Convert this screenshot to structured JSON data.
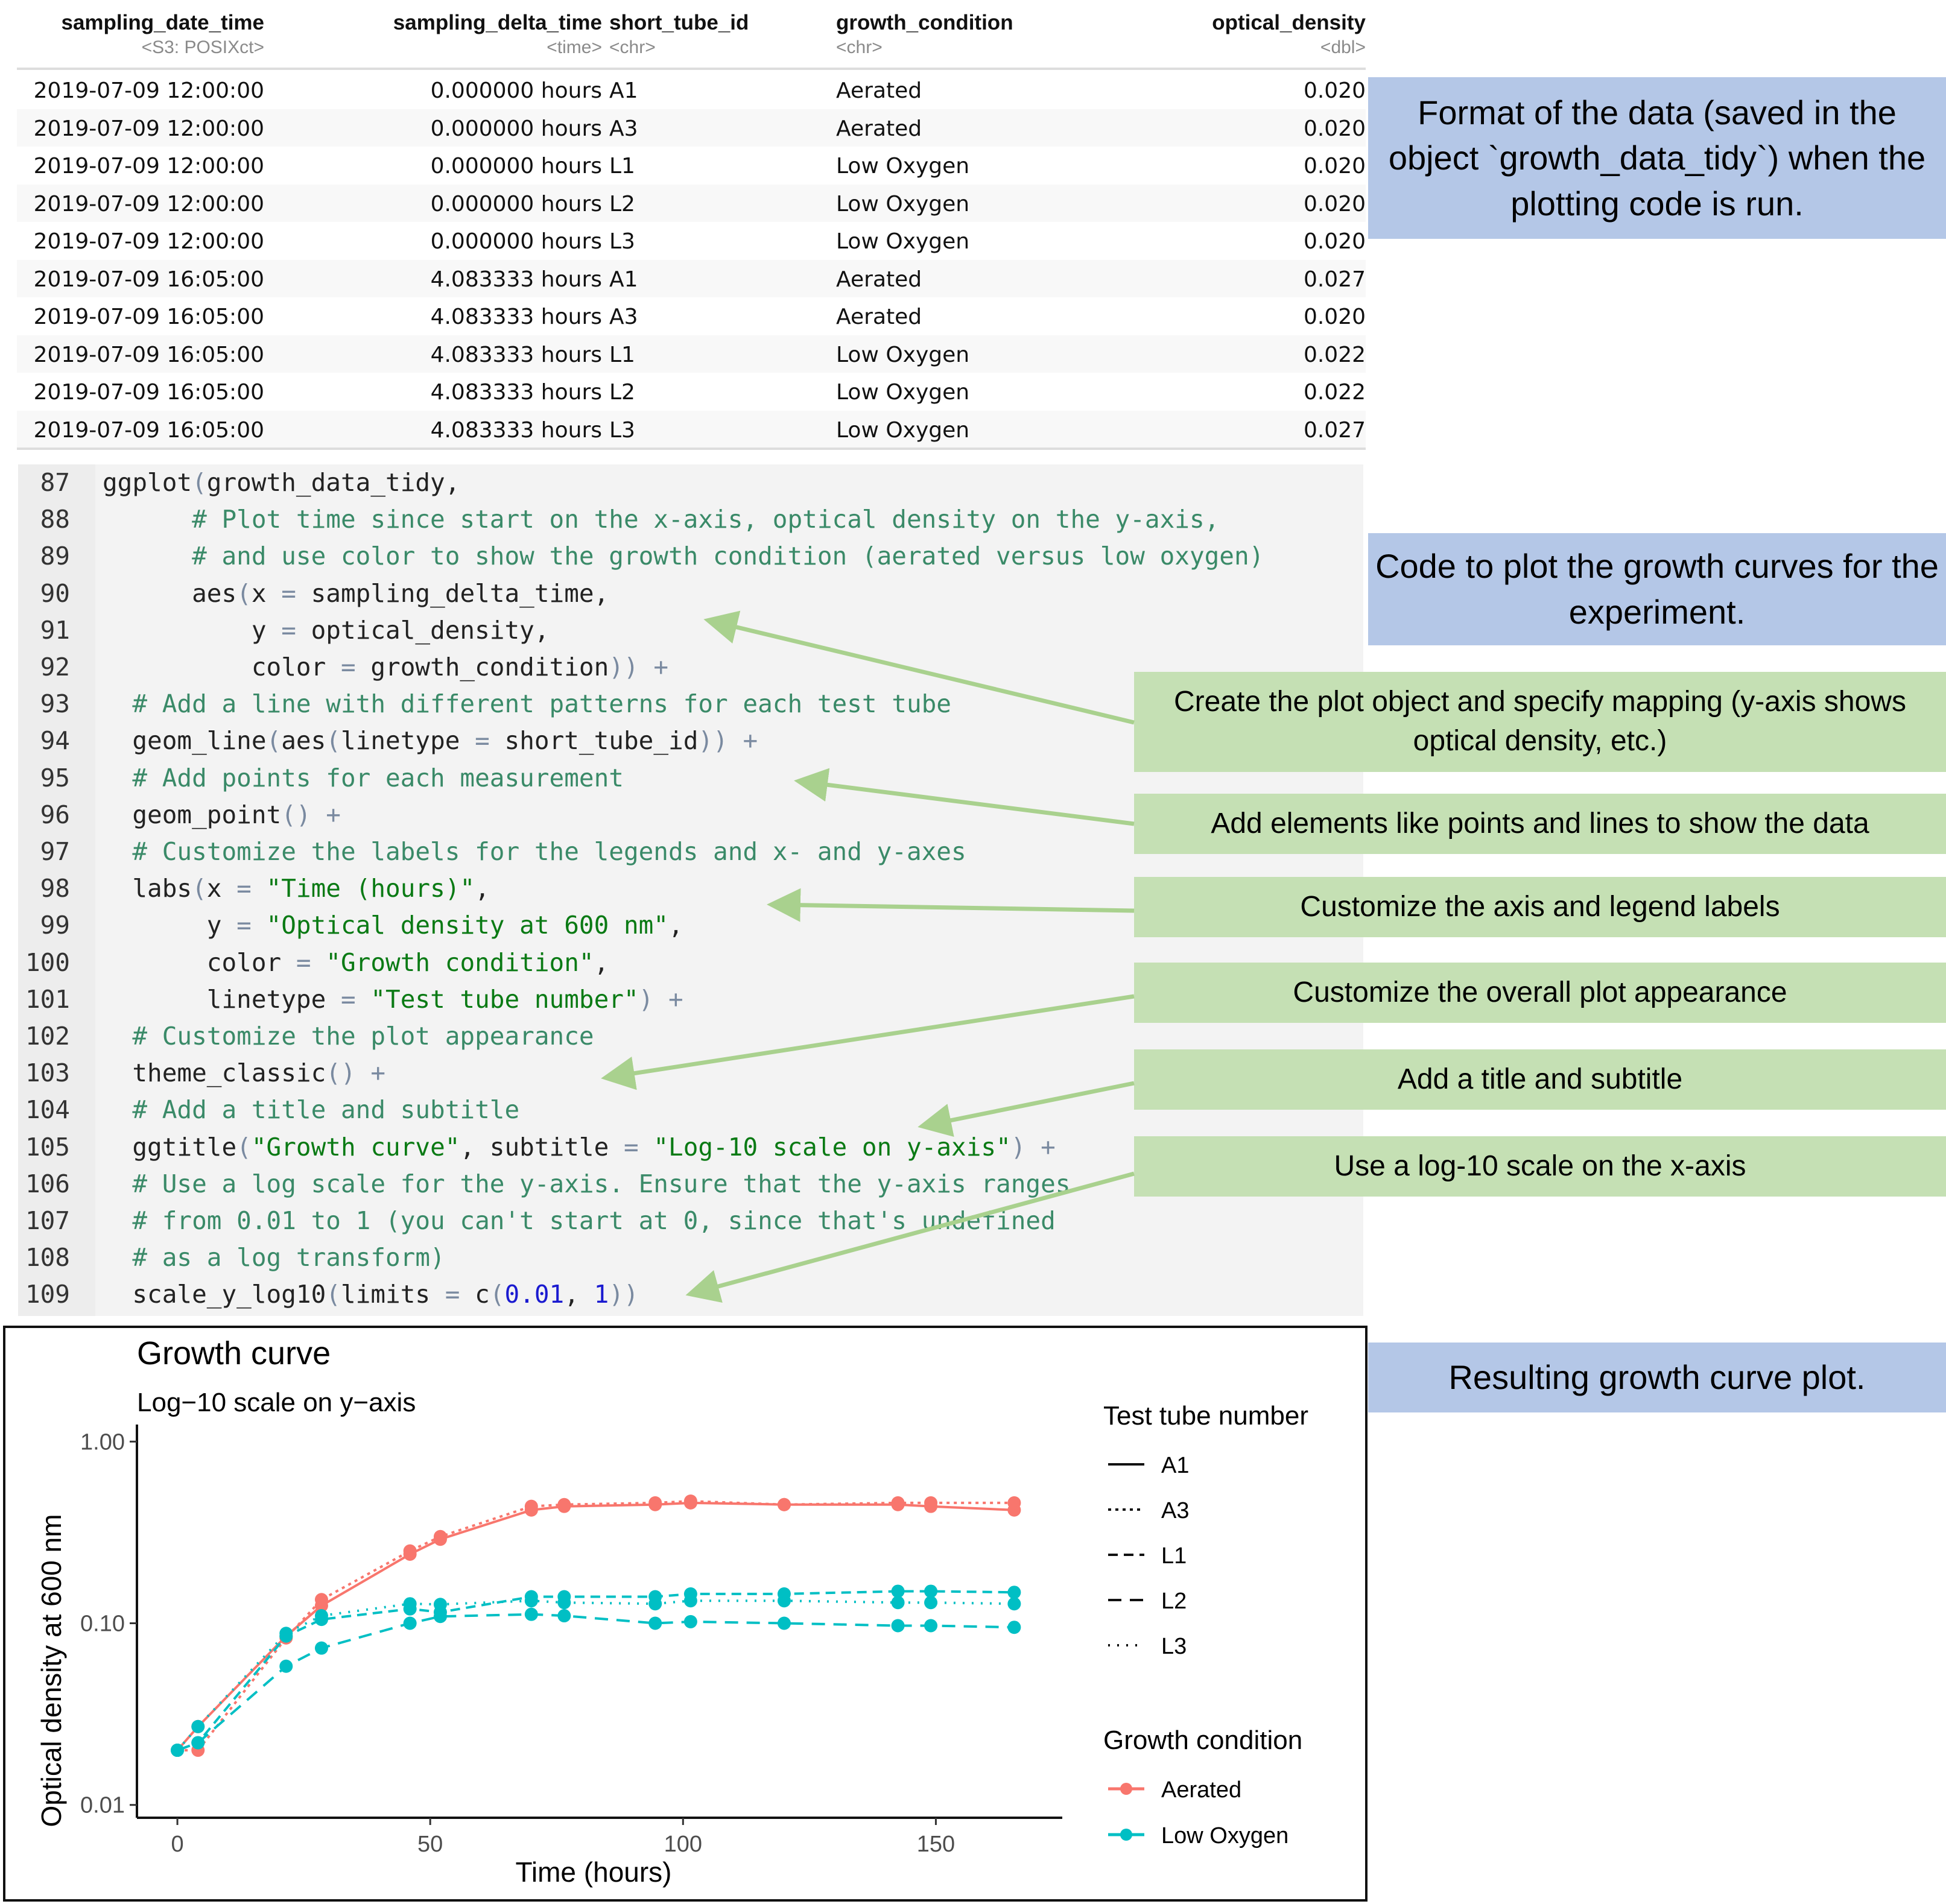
{
  "table": {
    "columns": [
      {
        "name": "sampling_date_time",
        "type": "<S3: POSIXct>"
      },
      {
        "name": "sampling_delta_time",
        "type": "<time>"
      },
      {
        "name": "short_tube_id",
        "type": "<chr>"
      },
      {
        "name": "growth_condition",
        "type": "<chr>"
      },
      {
        "name": "optical_density",
        "type": "<dbl>"
      }
    ],
    "rows": [
      [
        "2019-07-09 12:00:00",
        "0.000000 hours",
        "A1",
        "Aerated",
        "0.020"
      ],
      [
        "2019-07-09 12:00:00",
        "0.000000 hours",
        "A3",
        "Aerated",
        "0.020"
      ],
      [
        "2019-07-09 12:00:00",
        "0.000000 hours",
        "L1",
        "Low Oxygen",
        "0.020"
      ],
      [
        "2019-07-09 12:00:00",
        "0.000000 hours",
        "L2",
        "Low Oxygen",
        "0.020"
      ],
      [
        "2019-07-09 12:00:00",
        "0.000000 hours",
        "L3",
        "Low Oxygen",
        "0.020"
      ],
      [
        "2019-07-09 16:05:00",
        "4.083333 hours",
        "A1",
        "Aerated",
        "0.027"
      ],
      [
        "2019-07-09 16:05:00",
        "4.083333 hours",
        "A3",
        "Aerated",
        "0.020"
      ],
      [
        "2019-07-09 16:05:00",
        "4.083333 hours",
        "L1",
        "Low Oxygen",
        "0.022"
      ],
      [
        "2019-07-09 16:05:00",
        "4.083333 hours",
        "L2",
        "Low Oxygen",
        "0.022"
      ],
      [
        "2019-07-09 16:05:00",
        "4.083333 hours",
        "L3",
        "Low Oxygen",
        "0.027"
      ]
    ]
  },
  "code": {
    "lines": [
      {
        "n": "87",
        "segs": [
          [
            "ggplot",
            ""
          ],
          [
            "(",
            "op"
          ],
          [
            "growth_data_tidy,",
            ""
          ]
        ]
      },
      {
        "n": "88",
        "segs": [
          [
            "      # Plot time since start on the x-axis, optical density on the y-axis,",
            "cm"
          ]
        ]
      },
      {
        "n": "89",
        "segs": [
          [
            "      # and use color to show the growth condition (aerated versus low oxygen)",
            "cm"
          ]
        ]
      },
      {
        "n": "90",
        "segs": [
          [
            "      aes",
            ""
          ],
          [
            "(",
            "op"
          ],
          [
            "x ",
            ""
          ],
          [
            "=",
            "op"
          ],
          [
            " sampling_delta_time,",
            ""
          ]
        ]
      },
      {
        "n": "91",
        "segs": [
          [
            "          y ",
            ""
          ],
          [
            "=",
            "op"
          ],
          [
            " optical_density,",
            ""
          ]
        ]
      },
      {
        "n": "92",
        "segs": [
          [
            "          color ",
            ""
          ],
          [
            "=",
            "op"
          ],
          [
            " growth_condition",
            ""
          ],
          [
            "))",
            "op"
          ],
          [
            " +",
            "op"
          ]
        ]
      },
      {
        "n": "93",
        "segs": [
          [
            "  # Add a line with different patterns for each test tube",
            "cm"
          ]
        ]
      },
      {
        "n": "94",
        "segs": [
          [
            "  geom_line",
            ""
          ],
          [
            "(",
            "op"
          ],
          [
            "aes",
            ""
          ],
          [
            "(",
            "op"
          ],
          [
            "linetype ",
            ""
          ],
          [
            "=",
            "op"
          ],
          [
            " short_tube_id",
            ""
          ],
          [
            "))",
            "op"
          ],
          [
            " +",
            "op"
          ]
        ]
      },
      {
        "n": "95",
        "segs": [
          [
            "  # Add points for each measurement",
            "cm"
          ]
        ]
      },
      {
        "n": "96",
        "segs": [
          [
            "  geom_point",
            ""
          ],
          [
            "()",
            "op"
          ],
          [
            " +",
            "op"
          ]
        ]
      },
      {
        "n": "97",
        "segs": [
          [
            "  # Customize the labels for the legends and x- and y-axes",
            "cm"
          ]
        ]
      },
      {
        "n": "98",
        "segs": [
          [
            "  labs",
            ""
          ],
          [
            "(",
            "op"
          ],
          [
            "x ",
            ""
          ],
          [
            "=",
            "op"
          ],
          [
            " ",
            ""
          ],
          [
            "\"Time (hours)\"",
            "st"
          ],
          [
            ",",
            ""
          ]
        ]
      },
      {
        "n": "99",
        "segs": [
          [
            "       y ",
            ""
          ],
          [
            "=",
            "op"
          ],
          [
            " ",
            ""
          ],
          [
            "\"Optical density at 600 nm\"",
            "st"
          ],
          [
            ",",
            ""
          ]
        ]
      },
      {
        "n": "100",
        "segs": [
          [
            "       color ",
            ""
          ],
          [
            "=",
            "op"
          ],
          [
            " ",
            ""
          ],
          [
            "\"Growth condition\"",
            "st"
          ],
          [
            ",",
            ""
          ]
        ]
      },
      {
        "n": "101",
        "segs": [
          [
            "       linetype ",
            ""
          ],
          [
            "=",
            "op"
          ],
          [
            " ",
            ""
          ],
          [
            "\"Test tube number\"",
            "st"
          ],
          [
            ")",
            "op"
          ],
          [
            " +",
            "op"
          ]
        ]
      },
      {
        "n": "102",
        "segs": [
          [
            "  # Customize the plot appearance",
            "cm"
          ]
        ]
      },
      {
        "n": "103",
        "segs": [
          [
            "  theme_classic",
            ""
          ],
          [
            "()",
            "op"
          ],
          [
            " +",
            "op"
          ]
        ]
      },
      {
        "n": "104",
        "segs": [
          [
            "  # Add a title and subtitle",
            "cm"
          ]
        ]
      },
      {
        "n": "105",
        "segs": [
          [
            "  ggtitle",
            ""
          ],
          [
            "(",
            "op"
          ],
          [
            "\"Growth curve\"",
            "st"
          ],
          [
            ", subtitle ",
            ""
          ],
          [
            "=",
            "op"
          ],
          [
            " ",
            ""
          ],
          [
            "\"Log-10 scale on y-axis\"",
            "st"
          ],
          [
            ")",
            "op"
          ],
          [
            " +",
            "op"
          ]
        ]
      },
      {
        "n": "106",
        "segs": [
          [
            "  # Use a log scale for the y-axis. Ensure that the y-axis ranges",
            "cm"
          ]
        ]
      },
      {
        "n": "107",
        "segs": [
          [
            "  # from 0.01 to 1 (you can't start at 0, since that's undefined",
            "cm"
          ]
        ]
      },
      {
        "n": "108",
        "segs": [
          [
            "  # as a log transform)",
            "cm"
          ]
        ]
      },
      {
        "n": "109",
        "segs": [
          [
            "  scale_y_log10",
            ""
          ],
          [
            "(",
            "op"
          ],
          [
            "limits ",
            ""
          ],
          [
            "=",
            "op"
          ],
          [
            " c",
            ""
          ],
          [
            "(",
            "op"
          ],
          [
            "0.01",
            "nu"
          ],
          [
            ", ",
            ""
          ],
          [
            "1",
            "nu"
          ],
          [
            "))",
            "op"
          ]
        ]
      }
    ]
  },
  "annotations": {
    "blue": [
      "Format of the data (saved in the object `growth_data_tidy`) when the plotting code is run.",
      "Code to plot the growth curves for the experiment.",
      "Resulting growth curve plot."
    ],
    "green": [
      "Create the plot object and specify mapping (y-axis shows optical density, etc.)",
      "Add elements like points and lines to show the data",
      "Customize the axis and legend labels",
      "Customize the overall plot appearance",
      "Add a title and subtitle",
      "Use a log-10 scale on the x-axis"
    ]
  },
  "colors": {
    "aerated": "#F8766D",
    "low_oxygen": "#00BFC4",
    "blue_box": "#B4C7E7",
    "green_box": "#C5E0B4",
    "arrow": "#A9D18E"
  },
  "chart_data": {
    "type": "line",
    "title": "Growth curve",
    "subtitle": "Log−10 scale on y−axis",
    "xlabel": "Time (hours)",
    "ylabel": "Optical density at 600 nm",
    "xlim": [
      -8,
      175
    ],
    "ylim": [
      0.01,
      1
    ],
    "yscale": "log10",
    "x_ticks": [
      0,
      50,
      100,
      150
    ],
    "y_ticks": [
      0.01,
      0.1,
      1
    ],
    "y_tick_labels": [
      "0.01",
      "0.10",
      "1.00"
    ],
    "grid": false,
    "legend_placement": "right",
    "legend_linetype_title": "Test tube number",
    "legend_color_title": "Growth condition",
    "legend_linetype": [
      {
        "label": "A1",
        "dash": "solid"
      },
      {
        "label": "A3",
        "dash": "dotted-22"
      },
      {
        "label": "L1",
        "dash": "dashed-short"
      },
      {
        "label": "L2",
        "dash": "dashed-long"
      },
      {
        "label": "L3",
        "dash": "dotted"
      }
    ],
    "legend_color": [
      {
        "label": "Aerated",
        "color": "#F8766D"
      },
      {
        "label": "Low Oxygen",
        "color": "#00BFC4"
      }
    ],
    "x": [
      0,
      4.08,
      21.5,
      28.5,
      46,
      52,
      70,
      76.5,
      94.5,
      101.5,
      120,
      142.5,
      149,
      165.5
    ],
    "series": [
      {
        "name": "A1",
        "condition": "Aerated",
        "dash": "solid",
        "values": [
          0.02,
          0.027,
          0.085,
          0.125,
          0.24,
          0.29,
          0.42,
          0.44,
          0.45,
          0.46,
          0.45,
          0.45,
          0.44,
          0.42
        ]
      },
      {
        "name": "A3",
        "condition": "Aerated",
        "dash": "dotted-22",
        "values": [
          0.02,
          0.02,
          0.083,
          0.135,
          0.25,
          0.3,
          0.44,
          0.45,
          0.46,
          0.47,
          0.45,
          0.46,
          0.46,
          0.46
        ]
      },
      {
        "name": "L1",
        "condition": "Low Oxygen",
        "dash": "dashed-short",
        "values": [
          0.02,
          0.022,
          0.085,
          0.105,
          0.12,
          0.115,
          0.14,
          0.14,
          0.14,
          0.145,
          0.145,
          0.15,
          0.15,
          0.148
        ]
      },
      {
        "name": "L2",
        "condition": "Low Oxygen",
        "dash": "dashed-long",
        "values": [
          0.02,
          0.022,
          0.058,
          0.073,
          0.1,
          0.109,
          0.112,
          0.11,
          0.1,
          0.102,
          0.1,
          0.097,
          0.097,
          0.095
        ]
      },
      {
        "name": "L3",
        "condition": "Low Oxygen",
        "dash": "dotted",
        "values": [
          0.02,
          0.027,
          0.088,
          0.11,
          0.128,
          0.127,
          0.133,
          0.13,
          0.128,
          0.133,
          0.133,
          0.13,
          0.13,
          0.128
        ]
      }
    ]
  }
}
